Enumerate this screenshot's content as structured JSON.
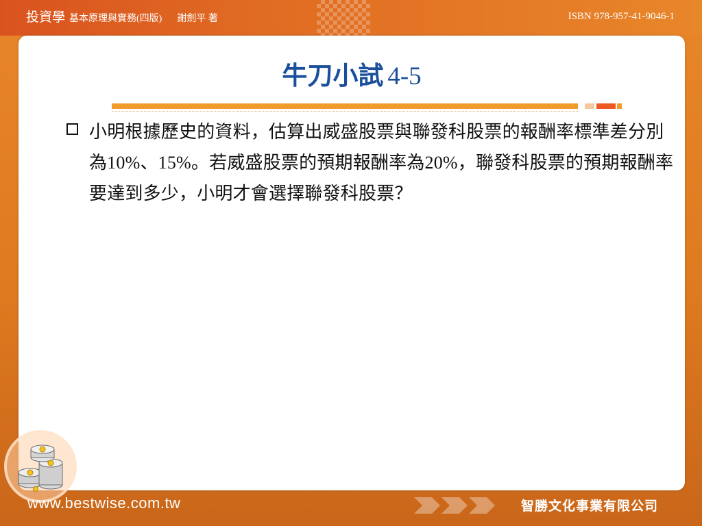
{
  "header": {
    "book_title": "投資學",
    "book_subtitle": "基本原理與實務(四版)",
    "author": "謝劍平 著",
    "isbn": "ISBN 978-957-41-9046-1"
  },
  "slide": {
    "title_text": "牛刀小試",
    "title_number": "4-5",
    "bullet_text": "小明根據歷史的資料，估算出威盛股票與聯發科股票的報酬率標準差分別為10%、15%。若威盛股票的預期報酬率為20%，聯發科股票的預期報酬率要達到多少，小明才會選擇聯發科股票？"
  },
  "footer": {
    "website": "www.bestwise.com.tw",
    "publisher": "智勝文化事業有限公司"
  },
  "colors": {
    "title_blue": "#1b4f9c",
    "accent_orange": "#f19b2c",
    "accent_red": "#ec5a22",
    "background_orange": "#e8862a"
  },
  "icons": {
    "bullet": "checkbox-square-icon",
    "decoration": "coin-stack-icon",
    "footer_arrows": "chevron-arrows-icon"
  }
}
